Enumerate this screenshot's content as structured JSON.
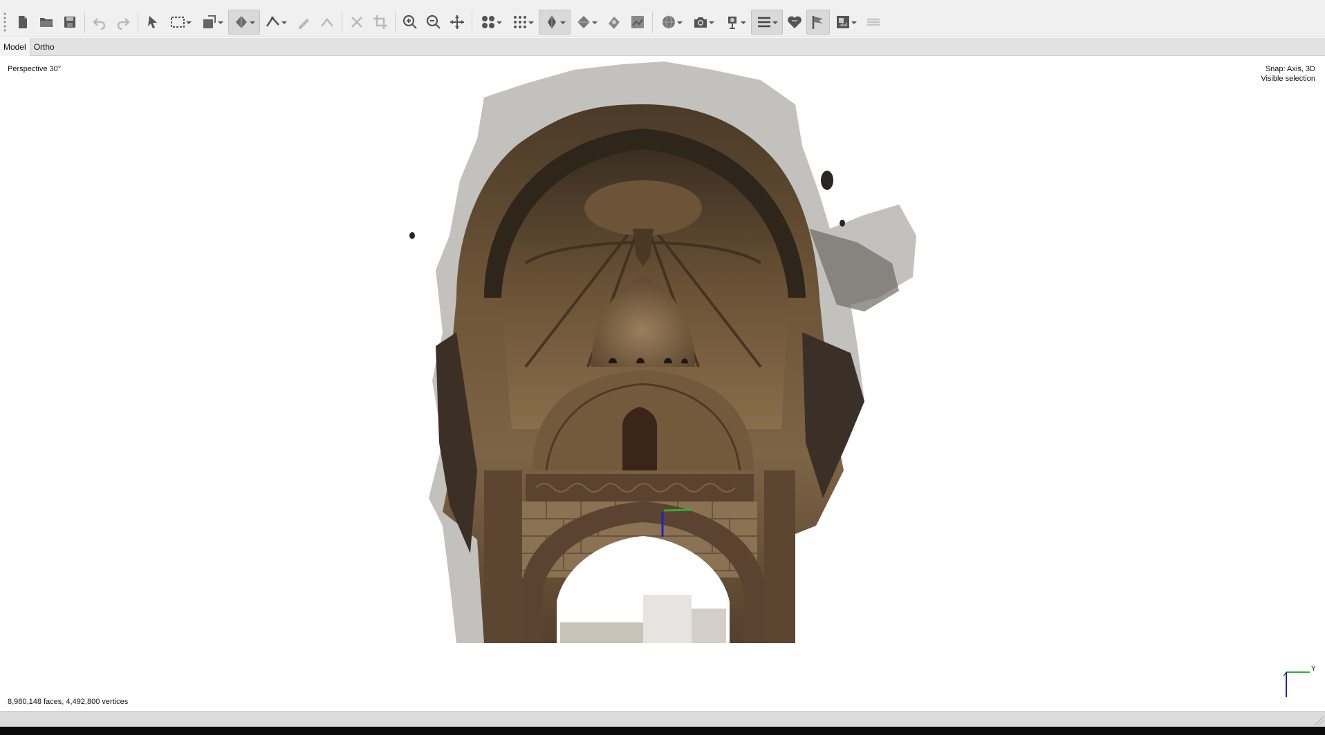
{
  "toolbar": {
    "icons": [
      "new-document-icon",
      "open-folder-icon",
      "save-icon",
      "undo-icon",
      "redo-icon",
      "select-pointer-icon",
      "rectangle-select-icon",
      "shape-select-icon",
      "move-object-icon",
      "ruler-icon",
      "draw-polyline-icon",
      "pencil-icon",
      "line-icon",
      "delete-icon",
      "crop-icon",
      "zoom-in-icon",
      "zoom-out-icon",
      "pan-icon",
      "show-cameras-icon",
      "show-points-icon",
      "show-model-icon",
      "show-tiled-model-icon",
      "texture-icon",
      "dem-icon",
      "sphere-icon",
      "camera-icon",
      "gimbal-icon",
      "menu-icon",
      "shape-heart-icon",
      "marker-flag-icon",
      "image-icon",
      "layers-icon"
    ]
  },
  "tabs": [
    {
      "label": "Model",
      "active": true
    },
    {
      "label": "Ortho",
      "active": false
    }
  ],
  "viewport": {
    "projection_label": "Perspective 30°",
    "snap_label": "Snap: Axis, 3D",
    "selection_label": "Visible selection",
    "stats_label": "8,980,148 faces, 4,492,800 vertices",
    "axis_y_label": "Y"
  },
  "colors": {
    "toolbar_bg": "#f0f0f0",
    "tabbar_bg": "#e2e2e2",
    "viewport_bg": "#ffffff",
    "stone_dark": "#3b2f22",
    "stone_mid": "#7a6244",
    "stone_light": "#a89070",
    "axis_green": "#2fae2f",
    "axis_blue": "#2020c8"
  }
}
